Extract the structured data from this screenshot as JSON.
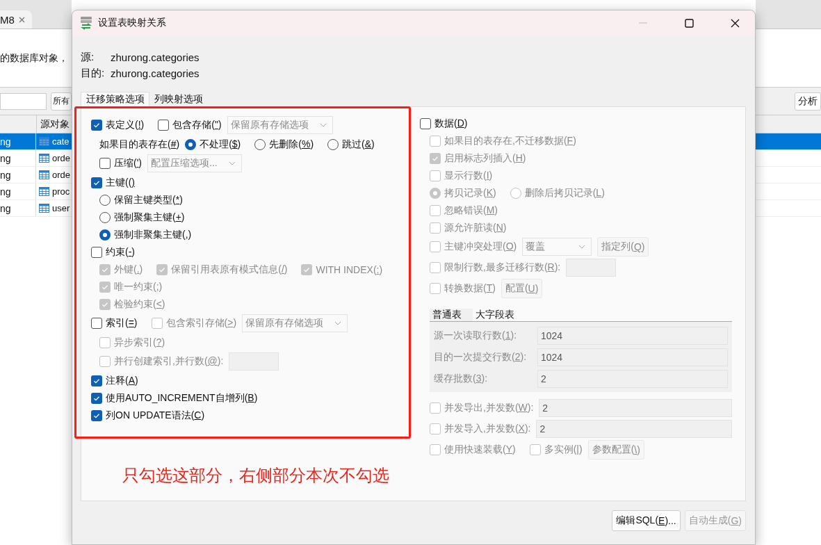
{
  "background": {
    "editor_tab": {
      "label": "M8"
    },
    "description": "的数据库对象，",
    "filter_button": "所有",
    "analyze_button": "分析",
    "table": {
      "columns": [
        {
          "label": "源对象"
        }
      ],
      "rows": [
        {
          "column_1": "ng",
          "source_object": "cate",
          "selected": true
        },
        {
          "column_1": "ng",
          "source_object": "orde",
          "selected": false
        },
        {
          "column_1": "ng",
          "source_object": "orde",
          "selected": false
        },
        {
          "column_1": "ng",
          "source_object": "proc",
          "selected": false
        },
        {
          "column_1": "ng",
          "source_object": "user",
          "selected": false
        }
      ]
    }
  },
  "dialog": {
    "title": "设置表映射关系",
    "source": {
      "label": "源:",
      "value": "zhurong.categories"
    },
    "target": {
      "label": "目的:",
      "value": "zhurong.categories"
    },
    "tabs": [
      {
        "label": "迁移策略选项",
        "selected": true
      },
      {
        "label": "列映射选项",
        "selected": false
      }
    ],
    "left_options": [
      {
        "kind": "main",
        "items": [
          {
            "kind": "checkbox",
            "label": "表定义(!)",
            "checked": true,
            "disabled": false
          },
          {
            "kind": "checkbox",
            "label": "包含存储(\")",
            "checked": false,
            "disabled": false
          },
          {
            "kind": "select",
            "value": "保留原有存储选项",
            "disabled": true
          }
        ]
      },
      {
        "kind": "sub",
        "items": [
          {
            "kind": "text",
            "label": "如果目的表存在(#)",
            "disabled": false
          },
          {
            "kind": "radio",
            "label": "不处理($)",
            "selected": true,
            "disabled": false
          },
          {
            "kind": "radio",
            "label": "先删除(%)",
            "selected": false,
            "disabled": false
          },
          {
            "kind": "radio",
            "label": "跳过(&)",
            "selected": false,
            "disabled": false
          }
        ]
      },
      {
        "kind": "sub",
        "items": [
          {
            "kind": "checkbox",
            "label": "压缩(')",
            "checked": false,
            "disabled": false
          },
          {
            "kind": "select",
            "value": "配置压缩选项...",
            "disabled": true
          }
        ]
      },
      {
        "kind": "main",
        "items": [
          {
            "kind": "checkbox",
            "label": "主键(()",
            "checked": true,
            "disabled": false
          }
        ]
      },
      {
        "kind": "sub",
        "items": [
          {
            "kind": "radio",
            "label": "保留主键类型(*)",
            "selected": false,
            "disabled": false
          }
        ]
      },
      {
        "kind": "sub",
        "items": [
          {
            "kind": "radio",
            "label": "强制聚集主键(+)",
            "selected": false,
            "disabled": false
          }
        ]
      },
      {
        "kind": "sub",
        "items": [
          {
            "kind": "radio",
            "label": "强制非聚集主键(,)",
            "selected": true,
            "disabled": false
          }
        ]
      },
      {
        "kind": "main",
        "items": [
          {
            "kind": "checkbox",
            "label": "约束(-)",
            "checked": false,
            "disabled": false
          }
        ]
      },
      {
        "kind": "sub",
        "items": [
          {
            "kind": "checkbox",
            "label": "外键(.)",
            "checked": true,
            "disabled": true
          },
          {
            "kind": "checkbox",
            "label": "保留引用表原有模式信息(/)",
            "checked": true,
            "disabled": true
          },
          {
            "kind": "checkbox",
            "label": "WITH INDEX(:)",
            "checked": true,
            "disabled": true
          }
        ]
      },
      {
        "kind": "sub",
        "items": [
          {
            "kind": "checkbox",
            "label": "唯一约束(;)",
            "checked": true,
            "disabled": true
          }
        ]
      },
      {
        "kind": "sub",
        "items": [
          {
            "kind": "checkbox",
            "label": "检验约束(<)",
            "checked": true,
            "disabled": true
          }
        ]
      },
      {
        "kind": "main",
        "items": [
          {
            "kind": "checkbox",
            "label": "索引(=)",
            "checked": false,
            "disabled": false
          },
          {
            "kind": "checkbox",
            "label": "包含索引存储(>)",
            "checked": false,
            "disabled": true
          },
          {
            "kind": "select",
            "value": "保留原有存储选项",
            "disabled": true
          }
        ]
      },
      {
        "kind": "sub",
        "items": [
          {
            "kind": "checkbox",
            "label": "异步索引(?)",
            "checked": false,
            "disabled": true
          }
        ]
      },
      {
        "kind": "sub",
        "items": [
          {
            "kind": "checkbox",
            "label": "并行创建索引,并行数(@):",
            "checked": false,
            "disabled": true
          },
          {
            "kind": "input",
            "disabled": true
          }
        ]
      },
      {
        "kind": "main",
        "items": [
          {
            "kind": "checkbox",
            "label": "注释(A)",
            "checked": true,
            "disabled": false
          }
        ]
      },
      {
        "kind": "main",
        "items": [
          {
            "kind": "checkbox",
            "label": "使用AUTO_INCREMENT自增列(B)",
            "checked": true,
            "disabled": false
          }
        ]
      },
      {
        "kind": "main",
        "items": [
          {
            "kind": "checkbox",
            "label": "列ON UPDATE语法(C)",
            "checked": true,
            "disabled": false
          }
        ]
      }
    ],
    "right_options": [
      {
        "kind": "main",
        "items": [
          {
            "kind": "checkbox",
            "label": "数据(D)",
            "checked": false,
            "disabled": false
          }
        ]
      },
      {
        "kind": "sub",
        "items": [
          {
            "kind": "checkbox",
            "label": "如果目的表存在,不迁移数据(F)",
            "checked": false,
            "disabled": true
          }
        ]
      },
      {
        "kind": "sub",
        "items": [
          {
            "kind": "checkbox",
            "label": "启用标志列插入(H)",
            "checked": true,
            "disabled": true
          }
        ]
      },
      {
        "kind": "sub",
        "items": [
          {
            "kind": "checkbox",
            "label": "显示行数(I)",
            "checked": false,
            "disabled": true
          }
        ]
      },
      {
        "kind": "sub",
        "items": [
          {
            "kind": "radio",
            "label": "拷贝记录(K)",
            "selected": true,
            "disabled": true
          },
          {
            "kind": "radio",
            "label": "删除后拷贝记录(L)",
            "selected": false,
            "disabled": true
          }
        ]
      },
      {
        "kind": "sub",
        "items": [
          {
            "kind": "checkbox",
            "label": "忽略错误(M)",
            "checked": false,
            "disabled": true
          }
        ]
      },
      {
        "kind": "sub",
        "items": [
          {
            "kind": "checkbox",
            "label": "源允许脏读(N)",
            "checked": false,
            "disabled": true
          }
        ]
      },
      {
        "kind": "sub",
        "items": [
          {
            "kind": "checkbox",
            "label": "主键冲突处理(O)",
            "checked": false,
            "disabled": true
          },
          {
            "kind": "select",
            "value": "覆盖",
            "disabled": true
          },
          {
            "kind": "button",
            "label": "指定列(Q)",
            "disabled": true
          }
        ]
      },
      {
        "kind": "sub",
        "items": [
          {
            "kind": "checkbox",
            "label": "限制行数,最多迁移行数(R):",
            "checked": false,
            "disabled": true
          },
          {
            "kind": "input",
            "disabled": true
          }
        ]
      },
      {
        "kind": "sub",
        "items": [
          {
            "kind": "checkbox",
            "label": "转换数据(T)",
            "checked": false,
            "disabled": true
          },
          {
            "kind": "button",
            "label": "配置(U)",
            "disabled": true
          }
        ]
      },
      {
        "kind": "tabs",
        "tabs": [
          {
            "label": "普通表",
            "selected": true
          },
          {
            "label": "大字段表",
            "selected": false
          }
        ],
        "fields": [
          {
            "label": "源一次读取行数(1):",
            "value": "1024",
            "disabled": true
          },
          {
            "label": "目的一次提交行数(2):",
            "value": "1024",
            "disabled": true
          },
          {
            "label": "缓存批数(3):",
            "value": "2",
            "disabled": true
          }
        ]
      },
      {
        "kind": "sub",
        "items": [
          {
            "kind": "checkbox",
            "label": "并发导出,并发数(W):",
            "checked": false,
            "disabled": true
          },
          {
            "kind": "wide_input",
            "value": "2",
            "disabled": true
          }
        ]
      },
      {
        "kind": "sub",
        "items": [
          {
            "kind": "checkbox",
            "label": "并发导入,并发数(X):",
            "checked": false,
            "disabled": true
          },
          {
            "kind": "wide_input",
            "value": "2",
            "disabled": true
          }
        ]
      },
      {
        "kind": "sub",
        "items": [
          {
            "kind": "checkbox",
            "label": "使用快速装载(Y)",
            "checked": false,
            "disabled": true
          },
          {
            "kind": "checkbox",
            "label": "多实例(|)",
            "checked": false,
            "disabled": true
          },
          {
            "kind": "button",
            "label": "参数配置(\\)",
            "disabled": true
          }
        ]
      }
    ],
    "buttons": [
      {
        "label": "编辑SQL(E)...",
        "disabled": false
      },
      {
        "label": "自动生成(G)",
        "disabled": true
      }
    ]
  },
  "annotation": {
    "text": "只勾选这部分，右侧部分本次不勾选"
  }
}
